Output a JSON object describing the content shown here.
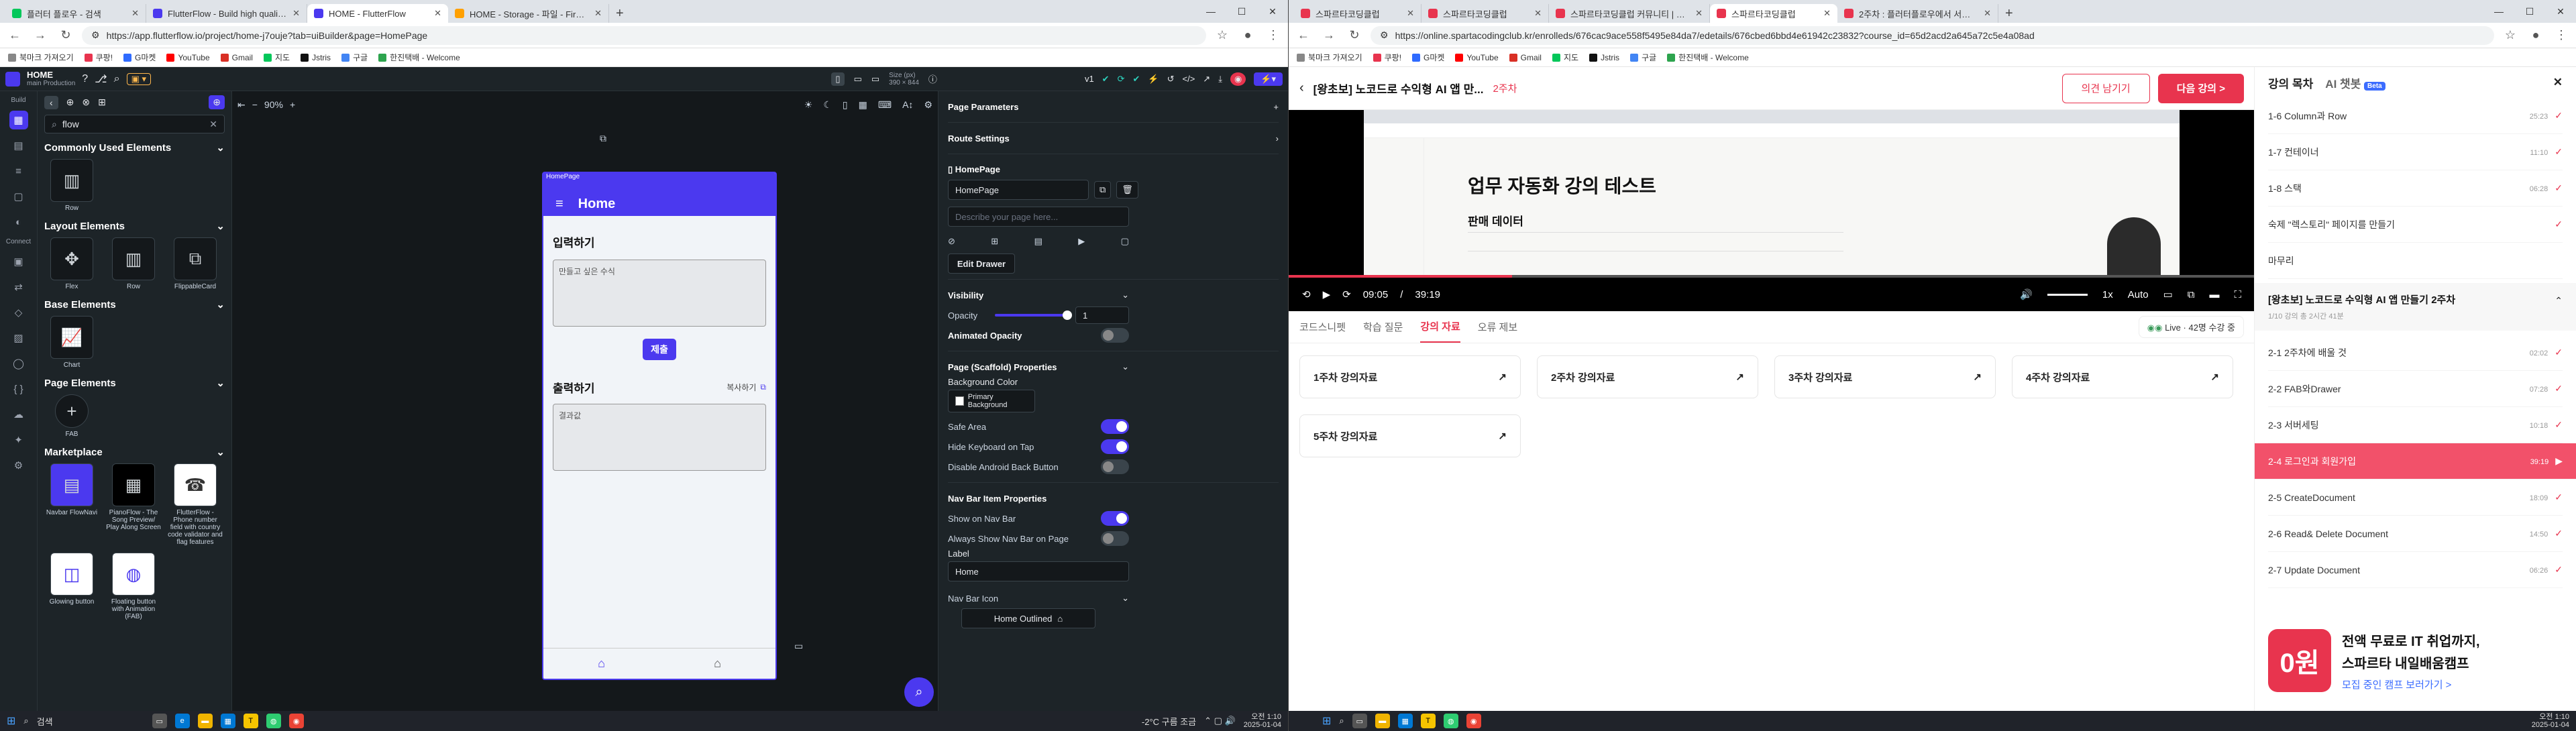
{
  "left": {
    "tabs": [
      {
        "label": "플러터 플로우 - 검색",
        "color": "#03c75a"
      },
      {
        "label": "FlutterFlow - Build high quality...",
        "color": "#4b39ef"
      },
      {
        "label": "HOME - FlutterFlow",
        "color": "#4b39ef",
        "active": true
      },
      {
        "label": "HOME - Storage - 파일 - Firebas...",
        "color": "#ffa000"
      }
    ],
    "url": "https://app.flutterflow.io/project/home-j7ouje?tab=uiBuilder&page=HomePage",
    "bookmarks": [
      "북마크 가져오기",
      "쿠팡!",
      "G마켓",
      "YouTube",
      "Gmail",
      "지도",
      "Jstris",
      "구글",
      "한진택배 - Welcome"
    ],
    "ff": {
      "project_name": "HOME",
      "project_sub": "main  Production",
      "search_value": "flow",
      "sections": [
        {
          "title": "Commonly Used Elements",
          "items": [
            {
              "label": "Row",
              "icon": "▥"
            }
          ]
        },
        {
          "title": "Layout Elements",
          "items": [
            {
              "label": "Flex",
              "icon": "✥"
            },
            {
              "label": "Row",
              "icon": "▥"
            },
            {
              "label": "FlippableCard",
              "icon": "⧉"
            }
          ]
        },
        {
          "title": "Base Elements",
          "items": [
            {
              "label": "Chart",
              "icon": "📈"
            }
          ]
        },
        {
          "title": "Page Elements",
          "items": [
            {
              "label": "FAB",
              "icon": "+"
            }
          ]
        },
        {
          "title": "Marketplace",
          "items": [
            {
              "label": "Navbar FlowNavi",
              "icon": "▤"
            },
            {
              "label": "PianoFlow - The Song Preview/ Play Along Screen",
              "icon": "▦"
            },
            {
              "label": "FlutterFlow - Phone number field with country code validator and flag features",
              "icon": "☎"
            },
            {
              "label": "Glowing button",
              "icon": "◫"
            },
            {
              "label": "Floating button with Animation (FAB)",
              "icon": "◍"
            }
          ]
        }
      ],
      "zoom": "90%",
      "device": "Size (px)\n390 × 844",
      "version": "v1",
      "phone": {
        "tag": "HomePage",
        "title": "Home",
        "input_heading": "입력하기",
        "input_placeholder": "만들고 싶은 수식",
        "submit": "제출",
        "output_heading": "출력하기",
        "copy": "복사하기",
        "output_value": "결과값"
      },
      "props": {
        "page_parameters": "Page Parameters",
        "route_settings": "Route Settings",
        "page_label": "HomePage",
        "page_name": "HomePage",
        "describe_placeholder": "Describe your page here...",
        "edit_drawer": "Edit Drawer",
        "visibility": "Visibility",
        "opacity": "Opacity",
        "opacity_value": "1",
        "animated_opacity": "Animated Opacity",
        "scaffold": "Page (Scaffold) Properties",
        "bg_color": "Background Color",
        "bg_value": "Primary Background",
        "safe_area": "Safe Area",
        "hide_keyboard": "Hide Keyboard on Tap",
        "disable_back": "Disable Android Back Button",
        "nav_props": "Nav Bar Item Properties",
        "show_nav": "Show on Nav Bar",
        "always_show": "Always Show Nav Bar on Page",
        "label": "Label",
        "label_value": "Home",
        "nav_icon": "Nav Bar Icon",
        "icon_value": "Home Outlined"
      }
    },
    "taskbar": {
      "search": "검색",
      "weather": "-2°C 구름 조금",
      "time": "오전 1:10",
      "date": "2025-01-04"
    }
  },
  "right": {
    "tabs": [
      {
        "label": "스파르타코딩클럽",
        "color": "#e8344e"
      },
      {
        "label": "스파르타코딩클럽",
        "color": "#e8344e"
      },
      {
        "label": "스파르타코딩클럽 커뮤니티 | 스파르...",
        "color": "#e8344e"
      },
      {
        "label": "스파르타코딩클럽",
        "color": "#e8344e",
        "active": true
      },
      {
        "label": "2주차 : 플러터플로우에서 서버연...",
        "color": "#e8344e"
      }
    ],
    "url": "https://online.spartacodingclub.kr/enrolleds/676cac9ace558f5495e84da7/edetails/676cbed6bbd4e61942c23832?course_id=65d2acd2a645a72c5e4a08ad",
    "course_title": "[왕초보] 노코드로 수익형 AI 앱 만...",
    "week": "2주차",
    "btn_comment": "의견 남기기",
    "btn_next": "다음 강의 >",
    "video": {
      "notion_title": "업무 자동화 강의 테스트",
      "sales_data": "판매 데이터",
      "time_current": "09:05",
      "time_total": "39:19",
      "progress": 0.231,
      "speed": "1x",
      "quality": "Auto"
    },
    "subtabs": [
      "코드스니펫",
      "학습 질문",
      "강의 자료",
      "오류 제보"
    ],
    "live": "Live · 42명 수강 중",
    "materials": [
      "1주차 강의자료",
      "2주차 강의자료",
      "3주차 강의자료",
      "4주차 강의자료",
      "5주차 강의자료"
    ],
    "side": {
      "tab1": "강의 목차",
      "tab2": "AI 챗봇",
      "beta": "Beta",
      "items_top": [
        {
          "n": "1-6  Column과 Row",
          "d": "25:23"
        },
        {
          "n": "1-7  컨테이너",
          "d": "11:10"
        },
        {
          "n": "1-8  스택",
          "d": "06:28"
        },
        {
          "n": "숙제  \"렉스토리\" 페이지를 만들기",
          "d": ""
        },
        {
          "n": "마무리",
          "d": ""
        }
      ],
      "week2_title": "[왕초보] 노코드로 수익형 AI 앱 만들기 2주차",
      "week2_sub": "1/10 강의   총 2시간 41분",
      "items": [
        {
          "n": "2-1  2주차에 배울 것",
          "d": "02:02",
          "active": false
        },
        {
          "n": "2-2  FAB와Drawer",
          "d": "07:28",
          "active": false
        },
        {
          "n": "2-3  서버세팅",
          "d": "10:18",
          "active": false
        },
        {
          "n": "2-4  로그인과 회원가입",
          "d": "39:19",
          "active": true
        },
        {
          "n": "2-5  CreateDocument",
          "d": "18:09",
          "active": false
        },
        {
          "n": "2-6  Read& Delete Document",
          "d": "14:50",
          "active": false
        },
        {
          "n": "2-7  Update Document",
          "d": "06:26",
          "active": false
        }
      ],
      "promo_badge": "0원",
      "promo_line1": "전액 무료로 IT 취업까지,",
      "promo_line2": "스파르타 내일배움캠프",
      "promo_link": "모집 중인 캠프 보러가기 >"
    },
    "taskbar": {
      "time": "오전 1:10",
      "date": "2025-01-04"
    }
  }
}
